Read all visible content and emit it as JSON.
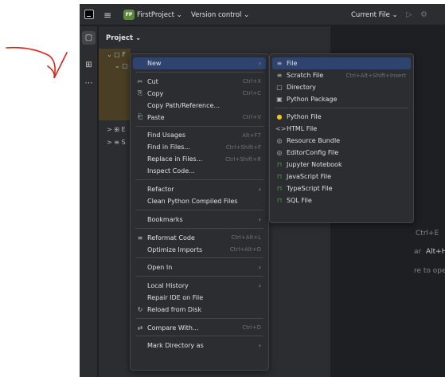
{
  "titlebar": {
    "project_badge": "FP",
    "project_name": "FirstProject ⌄",
    "version_control": "Version control ⌄",
    "run_config": "Current File ⌄"
  },
  "icons": {
    "hamburger": "≡",
    "run": "▷",
    "debug": "⚙",
    "folder": "▢",
    "structure": "⊞",
    "more": "⋯"
  },
  "project_panel": {
    "title": "Project ⌄",
    "tree": [
      "⌄ ▢ F",
      "⌄ ▢",
      "> ⊞ E",
      "> ≡ S"
    ]
  },
  "editor_hints": {
    "line1": "Ctrl+E",
    "line2_a": "ar",
    "line2_b": "Alt+Home",
    "line3": "re to open them"
  },
  "context_menu": [
    {
      "label": "New",
      "shortcut": "",
      "icon": "",
      "submenu": true,
      "selected": true
    },
    {
      "sep": true
    },
    {
      "label": "Cut",
      "shortcut": "Ctrl+X",
      "icon": "✂"
    },
    {
      "label": "Copy",
      "shortcut": "Ctrl+C",
      "icon": "⎘"
    },
    {
      "label": "Copy Path/Reference...",
      "shortcut": "",
      "icon": ""
    },
    {
      "label": "Paste",
      "shortcut": "Ctrl+V",
      "icon": "⎗"
    },
    {
      "sep": true
    },
    {
      "label": "Find Usages",
      "shortcut": "Alt+F7",
      "icon": ""
    },
    {
      "label": "Find in Files...",
      "shortcut": "Ctrl+Shift+F",
      "icon": ""
    },
    {
      "label": "Replace in Files...",
      "shortcut": "Ctrl+Shift+R",
      "icon": ""
    },
    {
      "label": "Inspect Code...",
      "shortcut": "",
      "icon": ""
    },
    {
      "sep": true
    },
    {
      "label": "Refactor",
      "shortcut": "",
      "icon": "",
      "submenu": true
    },
    {
      "label": "Clean Python Compiled Files",
      "shortcut": "",
      "icon": ""
    },
    {
      "sep": true
    },
    {
      "label": "Bookmarks",
      "shortcut": "",
      "icon": "",
      "submenu": true
    },
    {
      "sep": true
    },
    {
      "label": "Reformat Code",
      "shortcut": "Ctrl+Alt+L",
      "icon": "≡"
    },
    {
      "label": "Optimize Imports",
      "shortcut": "Ctrl+Alt+O",
      "icon": ""
    },
    {
      "sep": true
    },
    {
      "label": "Open In",
      "shortcut": "",
      "icon": "",
      "submenu": true
    },
    {
      "sep": true
    },
    {
      "label": "Local History",
      "shortcut": "",
      "icon": "",
      "submenu": true
    },
    {
      "label": "Repair IDE on File",
      "shortcut": "",
      "icon": ""
    },
    {
      "label": "Reload from Disk",
      "shortcut": "",
      "icon": "↻"
    },
    {
      "sep": true
    },
    {
      "label": "Compare With...",
      "shortcut": "Ctrl+D",
      "icon": "⇄"
    },
    {
      "sep": true
    },
    {
      "label": "Mark Directory as",
      "shortcut": "",
      "icon": "",
      "submenu": true
    }
  ],
  "new_submenu": [
    {
      "label": "File",
      "shortcut": "",
      "icon": "≡",
      "selected": true
    },
    {
      "label": "Scratch File",
      "shortcut": "Ctrl+Alt+Shift+Insert",
      "icon": "≡"
    },
    {
      "label": "Directory",
      "shortcut": "",
      "icon": "▢"
    },
    {
      "label": "Python Package",
      "shortcut": "",
      "icon": "▣"
    },
    {
      "sep": true
    },
    {
      "label": "Python File",
      "shortcut": "",
      "icon": "●"
    },
    {
      "label": "HTML File",
      "shortcut": "",
      "icon": "<>"
    },
    {
      "label": "Resource Bundle",
      "shortcut": "",
      "icon": "◎"
    },
    {
      "label": "EditorConfig File",
      "shortcut": "",
      "icon": "◎"
    },
    {
      "label": "Jupyter Notebook",
      "shortcut": "",
      "icon": "⊓"
    },
    {
      "label": "JavaScript File",
      "shortcut": "",
      "icon": "⊓"
    },
    {
      "label": "TypeScript File",
      "shortcut": "",
      "icon": "⊓"
    },
    {
      "label": "SQL File",
      "shortcut": "",
      "icon": "⊓"
    }
  ],
  "colors": {
    "selection": "#2e436e",
    "menu_bg": "#2b2d30",
    "annotation_arrow": "#d9251d",
    "python_icon": "#f2c12e",
    "lock_icon": "#57a64a"
  }
}
